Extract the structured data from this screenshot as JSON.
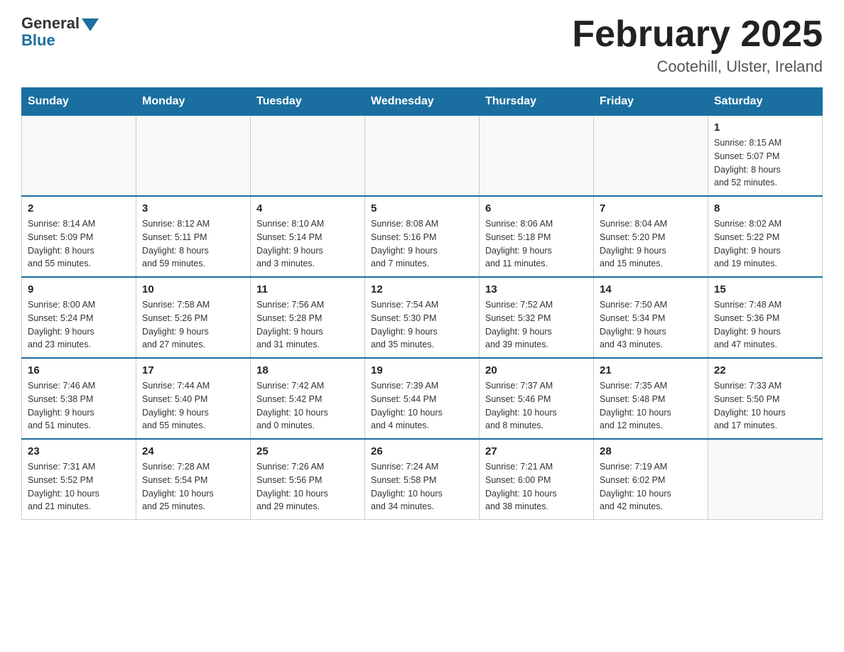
{
  "header": {
    "logo_general": "General",
    "logo_blue": "Blue",
    "month_title": "February 2025",
    "location": "Cootehill, Ulster, Ireland"
  },
  "weekdays": [
    "Sunday",
    "Monday",
    "Tuesday",
    "Wednesday",
    "Thursday",
    "Friday",
    "Saturday"
  ],
  "weeks": [
    [
      {
        "day": "",
        "info": ""
      },
      {
        "day": "",
        "info": ""
      },
      {
        "day": "",
        "info": ""
      },
      {
        "day": "",
        "info": ""
      },
      {
        "day": "",
        "info": ""
      },
      {
        "day": "",
        "info": ""
      },
      {
        "day": "1",
        "info": "Sunrise: 8:15 AM\nSunset: 5:07 PM\nDaylight: 8 hours\nand 52 minutes."
      }
    ],
    [
      {
        "day": "2",
        "info": "Sunrise: 8:14 AM\nSunset: 5:09 PM\nDaylight: 8 hours\nand 55 minutes."
      },
      {
        "day": "3",
        "info": "Sunrise: 8:12 AM\nSunset: 5:11 PM\nDaylight: 8 hours\nand 59 minutes."
      },
      {
        "day": "4",
        "info": "Sunrise: 8:10 AM\nSunset: 5:14 PM\nDaylight: 9 hours\nand 3 minutes."
      },
      {
        "day": "5",
        "info": "Sunrise: 8:08 AM\nSunset: 5:16 PM\nDaylight: 9 hours\nand 7 minutes."
      },
      {
        "day": "6",
        "info": "Sunrise: 8:06 AM\nSunset: 5:18 PM\nDaylight: 9 hours\nand 11 minutes."
      },
      {
        "day": "7",
        "info": "Sunrise: 8:04 AM\nSunset: 5:20 PM\nDaylight: 9 hours\nand 15 minutes."
      },
      {
        "day": "8",
        "info": "Sunrise: 8:02 AM\nSunset: 5:22 PM\nDaylight: 9 hours\nand 19 minutes."
      }
    ],
    [
      {
        "day": "9",
        "info": "Sunrise: 8:00 AM\nSunset: 5:24 PM\nDaylight: 9 hours\nand 23 minutes."
      },
      {
        "day": "10",
        "info": "Sunrise: 7:58 AM\nSunset: 5:26 PM\nDaylight: 9 hours\nand 27 minutes."
      },
      {
        "day": "11",
        "info": "Sunrise: 7:56 AM\nSunset: 5:28 PM\nDaylight: 9 hours\nand 31 minutes."
      },
      {
        "day": "12",
        "info": "Sunrise: 7:54 AM\nSunset: 5:30 PM\nDaylight: 9 hours\nand 35 minutes."
      },
      {
        "day": "13",
        "info": "Sunrise: 7:52 AM\nSunset: 5:32 PM\nDaylight: 9 hours\nand 39 minutes."
      },
      {
        "day": "14",
        "info": "Sunrise: 7:50 AM\nSunset: 5:34 PM\nDaylight: 9 hours\nand 43 minutes."
      },
      {
        "day": "15",
        "info": "Sunrise: 7:48 AM\nSunset: 5:36 PM\nDaylight: 9 hours\nand 47 minutes."
      }
    ],
    [
      {
        "day": "16",
        "info": "Sunrise: 7:46 AM\nSunset: 5:38 PM\nDaylight: 9 hours\nand 51 minutes."
      },
      {
        "day": "17",
        "info": "Sunrise: 7:44 AM\nSunset: 5:40 PM\nDaylight: 9 hours\nand 55 minutes."
      },
      {
        "day": "18",
        "info": "Sunrise: 7:42 AM\nSunset: 5:42 PM\nDaylight: 10 hours\nand 0 minutes."
      },
      {
        "day": "19",
        "info": "Sunrise: 7:39 AM\nSunset: 5:44 PM\nDaylight: 10 hours\nand 4 minutes."
      },
      {
        "day": "20",
        "info": "Sunrise: 7:37 AM\nSunset: 5:46 PM\nDaylight: 10 hours\nand 8 minutes."
      },
      {
        "day": "21",
        "info": "Sunrise: 7:35 AM\nSunset: 5:48 PM\nDaylight: 10 hours\nand 12 minutes."
      },
      {
        "day": "22",
        "info": "Sunrise: 7:33 AM\nSunset: 5:50 PM\nDaylight: 10 hours\nand 17 minutes."
      }
    ],
    [
      {
        "day": "23",
        "info": "Sunrise: 7:31 AM\nSunset: 5:52 PM\nDaylight: 10 hours\nand 21 minutes."
      },
      {
        "day": "24",
        "info": "Sunrise: 7:28 AM\nSunset: 5:54 PM\nDaylight: 10 hours\nand 25 minutes."
      },
      {
        "day": "25",
        "info": "Sunrise: 7:26 AM\nSunset: 5:56 PM\nDaylight: 10 hours\nand 29 minutes."
      },
      {
        "day": "26",
        "info": "Sunrise: 7:24 AM\nSunset: 5:58 PM\nDaylight: 10 hours\nand 34 minutes."
      },
      {
        "day": "27",
        "info": "Sunrise: 7:21 AM\nSunset: 6:00 PM\nDaylight: 10 hours\nand 38 minutes."
      },
      {
        "day": "28",
        "info": "Sunrise: 7:19 AM\nSunset: 6:02 PM\nDaylight: 10 hours\nand 42 minutes."
      },
      {
        "day": "",
        "info": ""
      }
    ]
  ]
}
